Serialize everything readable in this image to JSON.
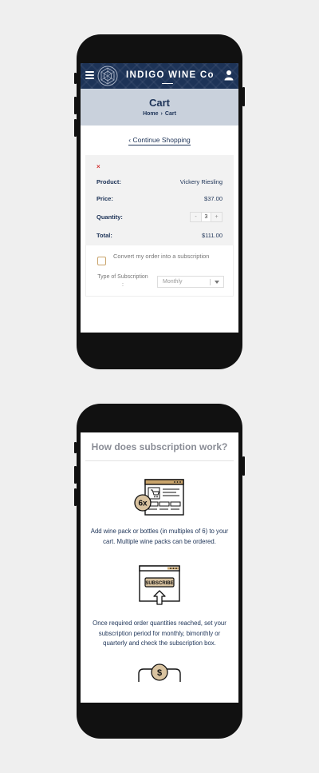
{
  "header": {
    "brand": "INDIGO WINE Co",
    "menu_icon": "hamburger-menu-icon",
    "user_icon": "user-icon",
    "colors": {
      "navy": "#1d3357",
      "banner": "#c9d1dc",
      "gold": "#c9a46b"
    }
  },
  "banner": {
    "title": "Cart",
    "breadcrumb_home": "Home",
    "breadcrumb_sep": "›",
    "breadcrumb_current": "Cart"
  },
  "continue_link": "Continue Shopping",
  "cart": {
    "remove": "×",
    "product_label": "Product:",
    "product_value": "Vickery Riesling",
    "price_label": "Price:",
    "price_value": "$37.00",
    "quantity_label": "Quantity:",
    "qty_minus": "-",
    "qty_value": "3",
    "qty_plus": "+",
    "total_label": "Total:",
    "total_value": "$111.00"
  },
  "subscription": {
    "convert_text": "Convert my order into a subscription",
    "type_label_line1": "Type of Subscription",
    "type_label_line2": ":",
    "type_selected": "Monthly"
  },
  "how": {
    "title": "How does subscription work?",
    "steps": [
      {
        "icon": "wine-cart-browser-icon",
        "badge": "6x",
        "text": "Add wine pack or bottles (in multiples of 6) to your cart. Multiple wine packs can be ordered."
      },
      {
        "icon": "subscribe-upload-icon",
        "badge": "SUBSCRIBE",
        "text": "Once required order quantities reached, set your subscription period for monthly, bimonthly or quarterly and check the subscription box."
      },
      {
        "icon": "dollar-coin-icon",
        "badge": "$"
      }
    ]
  }
}
